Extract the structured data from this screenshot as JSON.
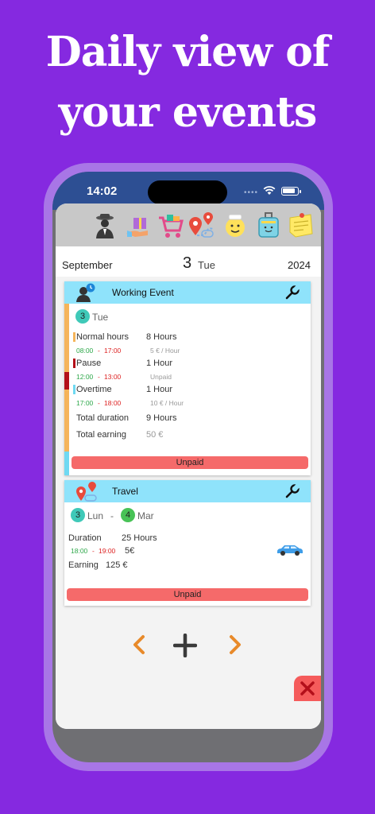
{
  "headline": {
    "line1": "Daily view of",
    "line2": "your events"
  },
  "status_bar": {
    "time": "14:02"
  },
  "toolbar": {
    "icons": [
      "worker-icon",
      "gift-icon",
      "shopping-cart-icon",
      "location-icon",
      "smiley-icon",
      "luggage-icon",
      "sticky-note-icon"
    ]
  },
  "date_bar": {
    "month": "September",
    "day": "3",
    "weekday": "Tue",
    "year": "2024"
  },
  "working_event": {
    "title": "Working Event",
    "day": "3",
    "weekday": "Tue",
    "rows": [
      {
        "label": "Normal hours",
        "value": "8 Hours",
        "start": "08:00",
        "sep": "-",
        "end": "17:00",
        "rate": "5 € / Hour",
        "color": "#f5b45a"
      },
      {
        "label": "Pause",
        "value": "1 Hour",
        "start": "12:00",
        "sep": "-",
        "end": "13:00",
        "rate": "Unpaid",
        "color": "#b3101a"
      },
      {
        "label": "Overtime",
        "value": "1 Hour",
        "start": "17:00",
        "sep": "-",
        "end": "18:00",
        "rate": "10 € / Hour",
        "color": "#6fd9f2"
      }
    ],
    "total_duration_label": "Total duration",
    "total_duration": "9 Hours",
    "total_earning_label": "Total earning",
    "total_earning": "50 €",
    "status": "Unpaid"
  },
  "travel": {
    "title": "Travel",
    "start_day": "3",
    "start_weekday": "Lun",
    "dash": "-",
    "end_day": "4",
    "end_weekday": "Mar",
    "duration_label": "Duration",
    "duration": "25 Hours",
    "start": "18:00",
    "sep": "-",
    "end": "19:00",
    "amount": "5€",
    "earning_label": "Earning",
    "earning": "125 €",
    "status": "Unpaid"
  },
  "colors": {
    "accent": "#8529e0",
    "header": "#8fe3fb",
    "unpaid": "#f56a6a",
    "nav_arrow": "#e88a2a"
  }
}
